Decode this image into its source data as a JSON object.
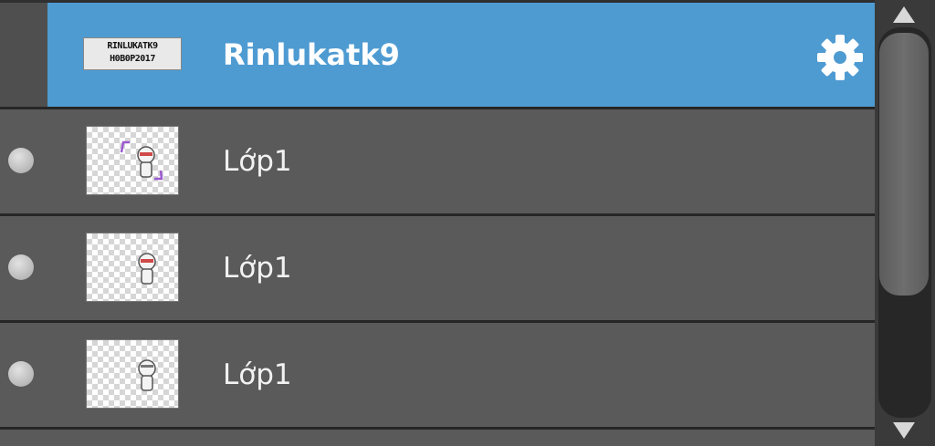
{
  "layers_panel": {
    "group": {
      "name": "Rinlukatk9",
      "thumbnail_lines": [
        "RINLUKATK9",
        "H0B0P2017"
      ],
      "selected": true,
      "icon": "gear-icon"
    },
    "layers": [
      {
        "name": "Lớp1",
        "visible_toggle": "radio-dot"
      },
      {
        "name": "Lớp1",
        "visible_toggle": "radio-dot"
      },
      {
        "name": "Lớp1",
        "visible_toggle": "radio-dot"
      }
    ],
    "scrollbar": {
      "up_icon": "arrow-up-icon",
      "down_icon": "arrow-down-icon"
    }
  },
  "colors": {
    "selected_row": "#4e9bd2",
    "row": "#5a5a5a",
    "text": "#f2f2f2"
  }
}
